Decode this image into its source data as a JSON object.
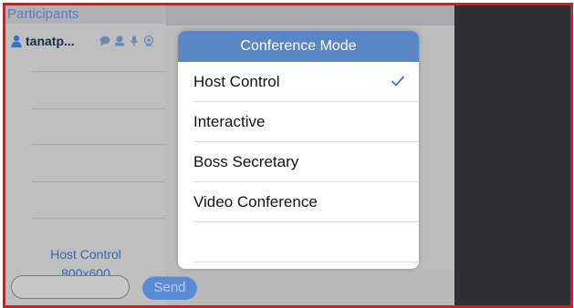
{
  "participants": {
    "title": "Participants",
    "rows": [
      {
        "name": "tanatp..."
      }
    ],
    "mode_label": "Host Control",
    "resolution_label": "800x600"
  },
  "chat": {
    "input_value": "",
    "send_label": "Send"
  },
  "conference_mode_menu": {
    "title": "Conference Mode",
    "items": [
      {
        "label": "Host Control",
        "selected": true
      },
      {
        "label": "Interactive",
        "selected": false
      },
      {
        "label": "Boss Secretary",
        "selected": false
      },
      {
        "label": "Video Conference",
        "selected": false
      },
      {
        "label": "",
        "selected": false
      }
    ]
  },
  "colors": {
    "frame": "#e8141b",
    "accent": "#5a86c4",
    "link_text": "#3b63b8"
  },
  "icons": [
    "person-icon",
    "chat-icon",
    "video-icon",
    "mic-icon",
    "camera-icon",
    "checkmark-icon"
  ]
}
